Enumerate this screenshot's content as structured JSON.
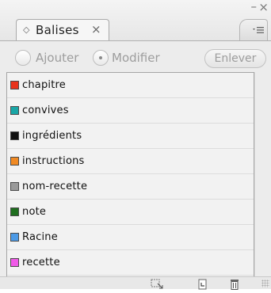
{
  "panel": {
    "tab_label": "Balises",
    "tab_close": "×",
    "tab_diamond": "◇",
    "window_minimize": "–",
    "window_close": "×",
    "menu_icon": "▾☰"
  },
  "controls": {
    "add_label": "Ajouter",
    "modify_label": "Modifier",
    "remove_label": "Enlever",
    "selected_mode": "modify"
  },
  "tags": [
    {
      "label": "chapitre",
      "color": "#e8331c"
    },
    {
      "label": "convives",
      "color": "#19a6a6"
    },
    {
      "label": "ingrédients",
      "color": "#111111"
    },
    {
      "label": "instructions",
      "color": "#f08a24"
    },
    {
      "label": "nom-recette",
      "color": "#9a9a9a"
    },
    {
      "label": "note",
      "color": "#1f6e1f"
    },
    {
      "label": "Racine",
      "color": "#4c9ae6"
    },
    {
      "label": "recette",
      "color": "#f05ae8"
    }
  ],
  "bottom_icons": [
    "new-tag-from-selection-icon",
    "new-tag-icon",
    "trash-icon"
  ]
}
